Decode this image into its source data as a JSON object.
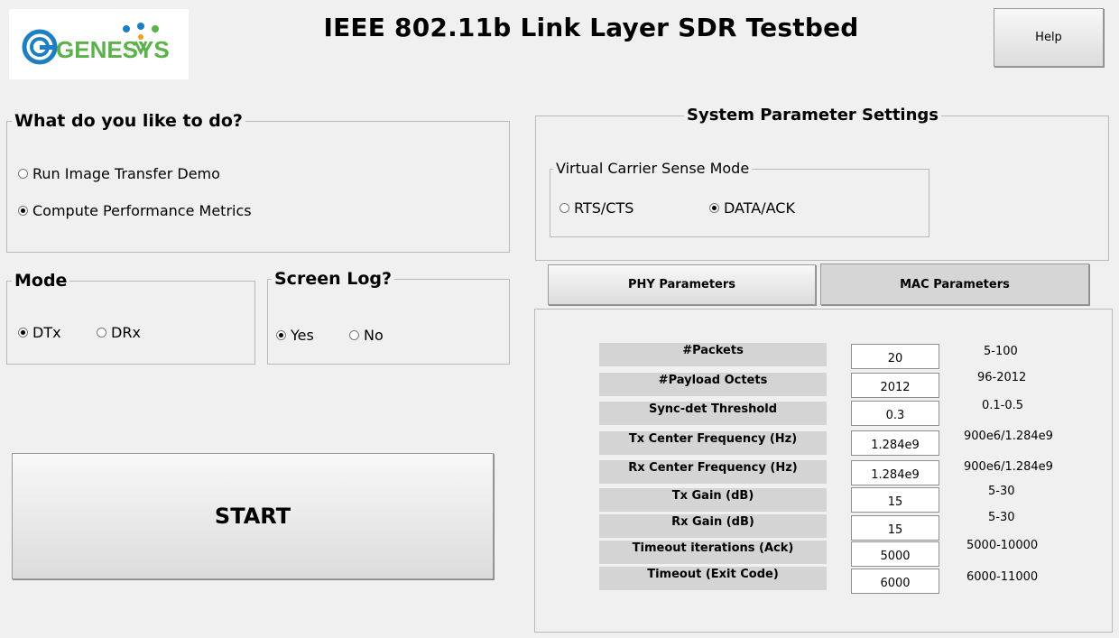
{
  "logo": {
    "text": "GENESYS"
  },
  "header": {
    "title": "IEEE 802.11b Link Layer SDR Testbed",
    "help_label": "Help"
  },
  "task": {
    "title": "What do you like to do?",
    "options": [
      {
        "label": "Run Image Transfer Demo",
        "selected": false
      },
      {
        "label": "Compute Performance Metrics",
        "selected": true
      }
    ]
  },
  "mode": {
    "title": "Mode",
    "options": [
      {
        "label": "DTx",
        "selected": true
      },
      {
        "label": "DRx",
        "selected": false
      }
    ]
  },
  "screen_log": {
    "title": "Screen Log?",
    "options": [
      {
        "label": "Yes",
        "selected": true
      },
      {
        "label": "No",
        "selected": false
      }
    ]
  },
  "start_label": "START",
  "system": {
    "title": "System Parameter Settings",
    "vcs": {
      "title": "Virtual Carrier Sense Mode",
      "options": [
        {
          "label": "RTS/CTS",
          "selected": false
        },
        {
          "label": "DATA/ACK",
          "selected": true
        }
      ]
    }
  },
  "tabs": [
    {
      "label": "PHY Parameters",
      "active": false
    },
    {
      "label": "MAC Parameters",
      "active": true
    }
  ],
  "params": [
    {
      "label": "#Packets",
      "value": "20",
      "range": "5-100"
    },
    {
      "label": "#Payload Octets",
      "value": "2012",
      "range": "96-2012"
    },
    {
      "label": "Sync-det Threshold",
      "value": "0.3",
      "range": "0.1-0.5"
    },
    {
      "label": "Tx Center Frequency (Hz)",
      "value": "1.284e9",
      "range": "900e6/1.284e9"
    },
    {
      "label": "Rx Center Frequency (Hz)",
      "value": "1.284e9",
      "range": "900e6/1.284e9"
    },
    {
      "label": "Tx Gain (dB)",
      "value": "15",
      "range": "5-30"
    },
    {
      "label": "Rx Gain (dB)",
      "value": "15",
      "range": "5-30"
    },
    {
      "label": "Timeout iterations (Ack)",
      "value": "5000",
      "range": "5000-10000"
    },
    {
      "label": "Timeout (Exit Code)",
      "value": "6000",
      "range": "6000-11000"
    }
  ],
  "colors": {
    "logo_blue": "#1d7fc1",
    "logo_green": "#5bb24a",
    "tab_active": "#d6d6d6",
    "label_bg": "#d4d4d4"
  }
}
